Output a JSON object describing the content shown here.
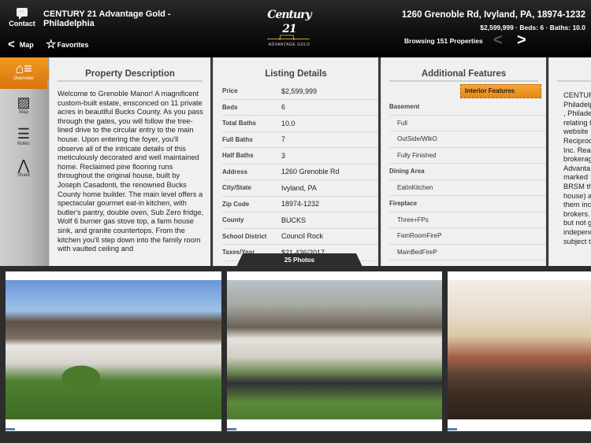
{
  "header": {
    "contact_label": "Contact",
    "office_name": "CENTURY 21 Advantage Gold - Philadelphia",
    "back_label": "Map",
    "favorites_label": "Favorites",
    "logo_word": "Century 21",
    "logo_sub": "ADVANTAGE GOLD",
    "address": "1260 Grenoble Rd, Ivyland, PA, 18974-1232",
    "summary": "$2,599,999 · Beds: 6 · Baths: 10.0",
    "browsing": "Browsing 151 Properties",
    "icons": {
      "contact": "chat-bubble-icon",
      "back": "chevron-left-icon",
      "favorites": "star-outline-icon",
      "prev": "chevron-left-icon",
      "next": "chevron-right-icon"
    }
  },
  "sidebar": {
    "items": [
      {
        "label": "Overview",
        "icon": "house-list-icon",
        "active": true
      },
      {
        "label": "Map",
        "icon": "map-icon",
        "active": false
      },
      {
        "label": "Notes",
        "icon": "notes-icon",
        "active": false
      },
      {
        "label": "Share",
        "icon": "share-icon",
        "active": false
      }
    ]
  },
  "description": {
    "title": "Property Description",
    "text": "Welcome to Grenoble Manor!  A magnificent custom-built estate, ensconced on 11 private acres in beautiful Bucks County. As you pass through the gates, you will follow the tree-lined drive to the circular entry to the main house. Upon entering the foyer, you'll observe all of the intricate details of this meticulously decorated and well maintained home. Reclaimed pine flooring runs throughout the original house, built by Joseph Casadonti, the renowned Bucks County home builder. The main level offers a spectacular gourmet eat-in kitchen, with butler's pantry, double oven, Sub Zero fridge, Wolf 6 burner gas stove top, a farm house sink, and granite countertops. From the kitchen you'll step down into the family room with vaulted ceiling and"
  },
  "listing": {
    "title": "Listing Details",
    "rows": [
      {
        "k": "Price",
        "v": "$2,599,999"
      },
      {
        "k": "Beds",
        "v": "6"
      },
      {
        "k": "Total Baths",
        "v": "10.0"
      },
      {
        "k": "Full Baths",
        "v": "7"
      },
      {
        "k": "Half Baths",
        "v": "3"
      },
      {
        "k": "Address",
        "v": "1260 Grenoble Rd"
      },
      {
        "k": "City/State",
        "v": "Ivyland, PA"
      },
      {
        "k": "Zip Code",
        "v": "18974-1232"
      },
      {
        "k": "County",
        "v": "BUCKS"
      },
      {
        "k": "School District",
        "v": "Council Rock"
      },
      {
        "k": "Taxes/Year",
        "v": "$21,436/2017"
      }
    ]
  },
  "features": {
    "title": "Additional Features",
    "tab_label": "Interior Features",
    "rows": [
      {
        "t": "Basement",
        "cat": true
      },
      {
        "t": "Full",
        "cat": false
      },
      {
        "t": "OutSide/WlkO",
        "cat": false
      },
      {
        "t": "Fully Finished",
        "cat": false
      },
      {
        "t": "Dining Area",
        "cat": true
      },
      {
        "t": "EatInKitchen",
        "cat": false
      },
      {
        "t": "Fireplace",
        "cat": true
      },
      {
        "t": "Three+FPs",
        "cat": false
      },
      {
        "t": "FamRoomFireP",
        "cat": false
      },
      {
        "t": "MainBedFireP",
        "cat": false
      }
    ]
  },
  "disclaimer": {
    "lines": [
      "CENTUR",
      "Philadelp",
      ", Philade",
      "relating t",
      "website",
      "Reciproc",
      "Inc. Real",
      "brokerag",
      "Advanta",
      "marked",
      "BRSM th",
      "house) a",
      "them inc",
      "brokers.",
      "but not g",
      "indepenc",
      "subject t"
    ]
  },
  "photos": {
    "count_label": "25 Photos",
    "items": [
      {
        "alt": "Aerial exterior of estate with circular driveway"
      },
      {
        "alt": "Front exterior with driveway and lawn"
      },
      {
        "alt": "Living room interior with hardwood floors"
      }
    ]
  }
}
